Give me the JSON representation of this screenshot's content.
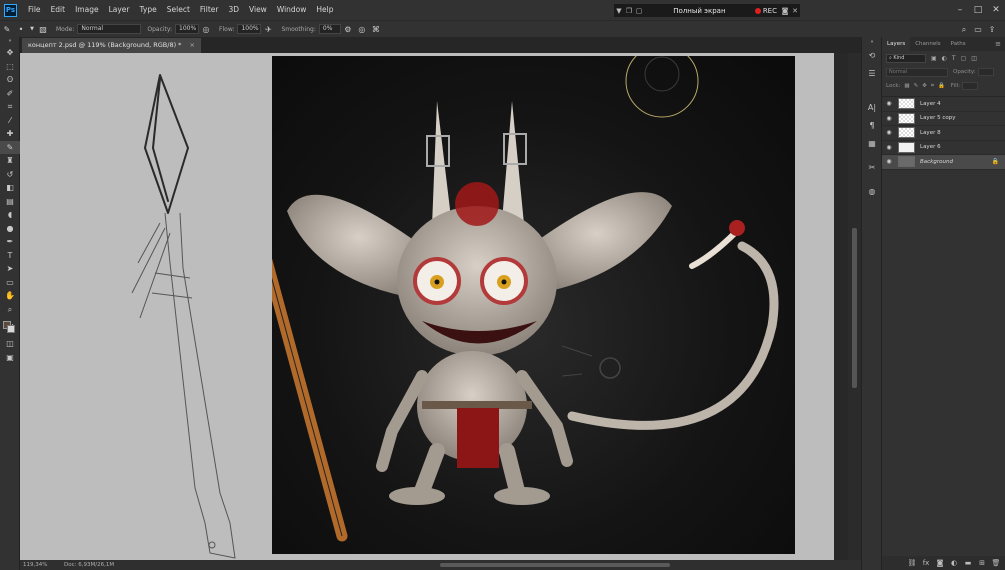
{
  "app": {
    "logo": "Ps"
  },
  "menu": [
    "File",
    "Edit",
    "Image",
    "Layer",
    "Type",
    "Select",
    "Filter",
    "3D",
    "View",
    "Window",
    "Help"
  ],
  "recorder": {
    "title": "Полный экран",
    "rec_label": "REC",
    "icons": [
      "chevron-down-icon",
      "copy-icon",
      "window-icon",
      "camera-icon",
      "close-icon"
    ]
  },
  "window_controls": [
    "minimize-icon",
    "maximize-icon",
    "close-icon"
  ],
  "options": {
    "mode_label": "Mode:",
    "mode_value": "Normal",
    "opacity_label": "Opacity:",
    "opacity_value": "100%",
    "flow_label": "Flow:",
    "flow_value": "100%",
    "smoothing_label": "Smoothing:",
    "smoothing_value": "0%"
  },
  "document": {
    "tab_title": "концепт 2.psd @ 119% (Background, RGB/8) *",
    "close": "×"
  },
  "status": {
    "zoom": "119,34%",
    "doc": "Doc: 6,93M/26,1M"
  },
  "colors": {
    "foreground": "#5a4a3e",
    "background": "#d9d9d9",
    "canvas": "#bdbdbd",
    "ui_dark": "#323232"
  },
  "layers_panel": {
    "tabs": [
      "Layers",
      "Channels",
      "Paths"
    ],
    "kind_label": "Kind",
    "blend_mode": "Normal",
    "opacity_label": "Opacity:",
    "lock_label": "Lock:",
    "fill_label": "Fill:",
    "layers": [
      {
        "name": "Layer 4",
        "type": "transparent"
      },
      {
        "name": "Layer 5 copy",
        "type": "transparent"
      },
      {
        "name": "Layer 8",
        "type": "transparent"
      },
      {
        "name": "Layer 6",
        "type": "sketch"
      },
      {
        "name": "Background",
        "type": "background",
        "locked": true
      }
    ]
  }
}
